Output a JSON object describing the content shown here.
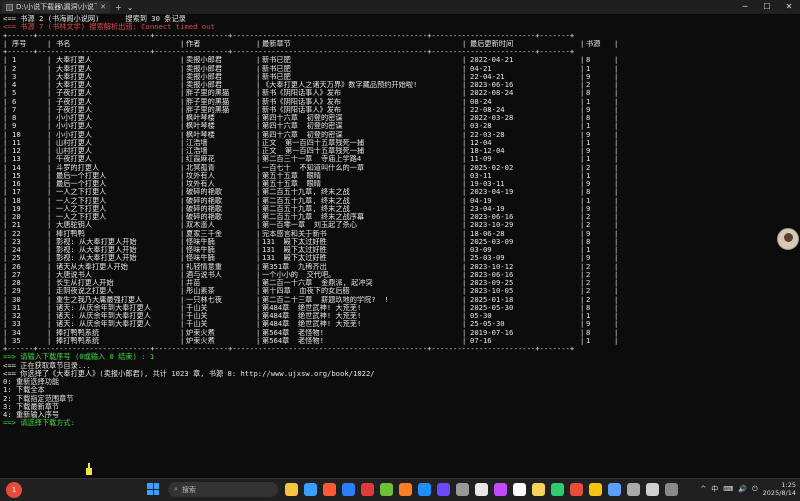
{
  "window": {
    "tab_title": "D:\\小说下载器\\漏洞\\小说下载\\",
    "new_tab": "+",
    "dropdown": "⌄",
    "controls": [
      "─",
      "☐",
      "✕"
    ]
  },
  "console": {
    "lines": [
      {
        "text": "<== 书源 2 (书海阁小说网)      搜索到 30 条记录",
        "cls": ""
      },
      {
        "text": "<== 书源 7 (书林文学) 搜索解析出错: Connect timed out",
        "cls": "red"
      }
    ],
    "table_border_top": "+------+--------------------------+-----------------+---------------------------------------------+------------------------+-------+",
    "headers": [
      "序号",
      "书名",
      "作者",
      "最新章节",
      "最后更新时间",
      "书源"
    ],
    "rows": [
      [
        "1",
        "大奉打更人",
        "卖报小郎君",
        "新书已肥",
        "2022-04-21",
        "8"
      ],
      [
        "2",
        "大奉打更人",
        "卖报小郎君",
        "新书已肥",
        "04-21",
        "1"
      ],
      [
        "3",
        "大奉打更人",
        "卖报小郎君",
        "新书已肥",
        "22-04-21",
        "9"
      ],
      [
        "4",
        "大奉打更人",
        "卖报小郎君",
        "《大奉打更人之诸天万界》数字藏品预约开始啦!",
        "2023-06-16",
        "2"
      ],
      [
        "5",
        "子夜打更人",
        "胖子里的黑猫",
        "新书《阴阳话事人》发布",
        "2022-08-24",
        "8"
      ],
      [
        "6",
        "子夜打更人",
        "胖子里的黑猫",
        "新书《阴阳话事人》发布",
        "08-24",
        "1"
      ],
      [
        "7",
        "子夜打更人",
        "胖子里的黑猫",
        "新书《阴阳话事人》发布",
        "22-08-24",
        "9"
      ],
      [
        "8",
        "小小打更人",
        "枫叶琴楼",
        "第四十六章  初登的密谋",
        "2022-03-28",
        "8"
      ],
      [
        "9",
        "小小打更人",
        "枫叶琴楼",
        "第四十六章  初登的密谋",
        "03-28",
        "1"
      ],
      [
        "10",
        "小小打更人",
        "枫叶琴楼",
        "第四十六章  初登的密谋",
        "22-03-28",
        "9"
      ],
      [
        "11",
        "山村打更人",
        "江浩墙",
        "正文  第一百四十五章残死一捕",
        "12-04",
        "1"
      ],
      [
        "12",
        "山村打更人",
        "江浩墙",
        "正文  第一百四十五章残死一捕",
        "18-12-04",
        "9"
      ],
      [
        "13",
        "午夜打更人",
        "红霞麻花",
        "第二百三十一章  寺庙上学路4",
        "11-09",
        "1"
      ],
      [
        "14",
        "斗罗的打更人",
        "北冥孤青",
        "一百七十  不知道叫什么的一章",
        "2025-02-02",
        "2"
      ],
      [
        "15",
        "最后一个打更人",
        "坟外有人",
        "第五十五章  眼晴",
        "03-11",
        "1"
      ],
      [
        "16",
        "最后一个打更人",
        "坟外有人",
        "第五十五章  眼晴",
        "19-03-11",
        "9"
      ],
      [
        "17",
        "一人之下打更人",
        "破碎的艳歌",
        "第二百五十九章, 终末之战",
        "2023-04-19",
        "8"
      ],
      [
        "18",
        "一人之下打更人",
        "破碎的艳歌",
        "第二百五十九章, 终末之战",
        "04-19",
        "1"
      ],
      [
        "19",
        "一人之下打更人",
        "破碎的艳歌",
        "第二百五十九章, 终末之战",
        "23-04-19",
        "9"
      ],
      [
        "20",
        "一人之下打更人",
        "破碎的艳歌",
        "第二百五十九章  终末之战序幕",
        "2023-06-16",
        "2"
      ],
      [
        "21",
        "大唐驼钥人",
        "双木遥人",
        "第一百零一章  刘玉起了杀心",
        "2023-10-29",
        "2"
      ],
      [
        "22",
        "棒打鸭鸭",
        "夏家三千金",
        "完本感言和关于新书",
        "18-06-28",
        "9"
      ],
      [
        "23",
        "影视: 从大奉打更人开始",
        "怪味牛腩",
        "131  殿下太过好胜",
        "2025-03-09",
        "8"
      ],
      [
        "24",
        "影视: 从大奉打更人开始",
        "怪味牛腩",
        "131  殿下太过好胜",
        "03-09",
        "1"
      ],
      [
        "25",
        "影视: 从大奉打更人开始",
        "怪味牛腩",
        "131  殿下太过好胜",
        "25-03-09",
        "9"
      ],
      [
        "26",
        "诸天从大奉打更人开始",
        "礼轻情意重",
        "第351章  九稀齐出",
        "2023-10-12",
        "2"
      ],
      [
        "27",
        "大唐说书人",
        "酒与说书人",
        "一个小小的  交代吧。",
        "2023-06-16",
        "2"
      ],
      [
        "28",
        "长生从打更人开始",
        "井苗",
        "第二百一十六章  金鼎派, 起冲突",
        "2023-09-25",
        "2"
      ],
      [
        "29",
        "走阴夜说之打更人",
        "彤山素茶",
        "第十四章  血夜下的女后腊",
        "2023-10-05",
        "2"
      ],
      [
        "30",
        "重生之我乃大庸最强打更人",
        "一只林七夜",
        "第二百二十三章  薪题玖地的学院?  !",
        "2025-01-18",
        "2"
      ],
      [
        "31",
        "诸天: 从庆余年到大奉打更人",
        "千山关",
        "第484章  绝世武神! 大荒芜!",
        "2025-05-30",
        "8"
      ],
      [
        "32",
        "诸天: 从庆余年到大奉打更人",
        "千山关",
        "第484章  绝世武神! 大荒芜!",
        "05-30",
        "1"
      ],
      [
        "33",
        "诸天: 从庆余年到大奉打更人",
        "千山关",
        "第484章  绝世武神! 大荒芜!",
        "25-05-30",
        "9"
      ],
      [
        "34",
        "捧打鸭鸭系统",
        "炉束火煮",
        "第564章  老怪物!",
        "2019-07-16",
        "8"
      ],
      [
        "35",
        "捧打鸭鸭系统",
        "炉束火煮",
        "第564章  老怪物!",
        "07-16",
        "1"
      ]
    ],
    "after": [
      {
        "text": "==> 请输入下载序号 (0或输入 0 结束) : 1",
        "cls": "green"
      },
      {
        "text": "<== 正在获取章节目录...",
        "cls": ""
      },
      {
        "text": "<== 你选择了《大奉打更人》(卖报小郎君), 共计 1023 章, 书源 8: http://www.ujxsw.org/book/1022/",
        "cls": ""
      },
      {
        "text": "0: 重新选择功能",
        "cls": ""
      },
      {
        "text": "1: 下载全本",
        "cls": ""
      },
      {
        "text": "2: 下载指定范围章节",
        "cls": ""
      },
      {
        "text": "3: 下载最新章节",
        "cls": ""
      },
      {
        "text": "4: 重新输入序号",
        "cls": ""
      },
      {
        "text": "==> 请选择下载方式:",
        "cls": "green"
      }
    ]
  },
  "taskbar": {
    "weather_badge": "1",
    "search_placeholder": "搜索",
    "time": "1:25",
    "date": "2025/8/14",
    "tray_icons": [
      "^",
      "中",
      "⌨",
      "🔊",
      "⏻"
    ],
    "app_colors": [
      "#f5c542",
      "#3aa0ff",
      "#ff5a36",
      "#2d7ff9",
      "#e03a3a",
      "#6fbf3a",
      "#ff7f27",
      "#1e90ff",
      "#6c48ff",
      "#999999",
      "#e8e8e8",
      "#c04cff",
      "#ffffff",
      "#f5d35a",
      "#2ecc71",
      "#e74c3c",
      "#f1c40f",
      "#5aa0ff",
      "#aaaaaa",
      "#d0d0d0",
      "#8a8a8a"
    ]
  }
}
